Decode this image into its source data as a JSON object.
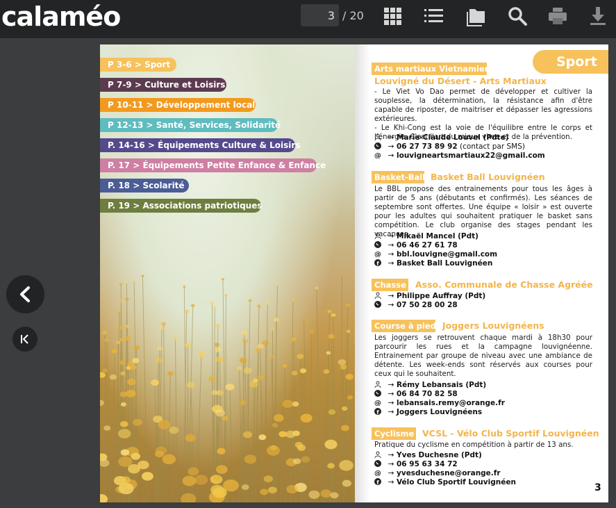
{
  "app": {
    "logo": "calaméo"
  },
  "toolbar": {
    "current_page": "3",
    "total_pages": "/ 20",
    "icons": [
      "grid-view-icon",
      "list-view-icon",
      "folder-icon",
      "search-icon",
      "print-icon",
      "download-icon"
    ]
  },
  "nav": {
    "prev_icon": "chevron-left-icon",
    "first_icon": "first-page-icon"
  },
  "index": [
    {
      "label": "P 3-6  >  Sport",
      "color": "#f7c15b"
    },
    {
      "label": "P 7-9  >  Culture et Loisirs",
      "color": "#5c3b4f"
    },
    {
      "label": "P 10-11  >  Développement local",
      "color": "#f29a1f"
    },
    {
      "label": "P 12-13  >  Santé, Services, Solidarité",
      "color": "#5fbcbf"
    },
    {
      "label": "P. 14-16  >  Équipements Culture & Loisirs",
      "color": "#544a8c"
    },
    {
      "label": "P. 17  >  Équipements Petite Enfance & Enfance",
      "color": "#cf7fa3"
    },
    {
      "label": "P. 18  >  Scolarité",
      "color": "#4b5c96"
    },
    {
      "label": "P. 19  >  Associations patriotiques",
      "color": "#6e7e3f"
    }
  ],
  "right_page": {
    "section_tab": "Sport",
    "page_number": "3",
    "sections": [
      {
        "category": "Arts martiaux Vietnamiens",
        "club": "Louvigné du Désert - Arts Martiaux",
        "paragraph_lines": [
          "- Le Viet Vo Dao permet de développer et cultiver la souplesse, la détermination, la résistance afin d'être capable de riposter, de maitriser et dépasser les agressions extérieures.",
          "- Le Khi-Cong est la voie de l'équilibre entre le corps et l'énergie. C'est l'art du mieux vivre et de la prévention."
        ],
        "contacts": [
          {
            "icon": "person-icon",
            "text": "Marie-Claude Louvel (Pdte)",
            "note": ""
          },
          {
            "icon": "phone-icon",
            "text": "06 27 73 89 92",
            "note": " (contact par SMS)"
          },
          {
            "icon": "at-icon",
            "text": "louvigneartsmartiaux22@gmail.com",
            "note": ""
          }
        ]
      },
      {
        "category": "Basket-Ball",
        "club": "Basket Ball Louvignéen",
        "paragraph_lines": [
          "Le BBL propose des entrainements pour tous les âges à partir de 5 ans (débutants et confirmés). Les séances de septembre sont offertes. Une équipe « loisir » est ouverte pour les adultes qui souhaitent pratiquer le basket sans compétition. Le club organise des stages pendant les vacances."
        ],
        "contacts": [
          {
            "icon": "person-icon",
            "text": "Mikaël Mancel (Pdt)",
            "note": ""
          },
          {
            "icon": "phone-icon",
            "text": "06 46 27 61 78",
            "note": ""
          },
          {
            "icon": "at-icon",
            "text": "bbl.louvigne@gmail.com",
            "note": ""
          },
          {
            "icon": "facebook-icon",
            "text": "Basket Ball Louvignéen",
            "note": ""
          }
        ]
      },
      {
        "category": "Chasse",
        "club": "Asso. Communale de Chasse Agréée",
        "paragraph_lines": [],
        "contacts": [
          {
            "icon": "person-icon",
            "text": "Philippe Auffray (Pdt)",
            "note": ""
          },
          {
            "icon": "phone-icon",
            "text": "07 50 28 00 28",
            "note": ""
          }
        ]
      },
      {
        "category": "Course à pied",
        "club": "Joggers Louvignéens",
        "paragraph_lines": [
          "Les joggers se retrouvent chaque mardi à 18h30 pour parcourir les rues et la campagne louvignéenne. Entrainement par groupe de niveau avec une ambiance de détente. Les week-ends sont réservés aux courses pour ceux qui le souhaitent."
        ],
        "contacts": [
          {
            "icon": "person-icon",
            "text": "Rémy Lebansais (Pdt)",
            "note": ""
          },
          {
            "icon": "phone-icon",
            "text": "06 84 70 82 58",
            "note": ""
          },
          {
            "icon": "at-icon",
            "text": "lebansais.remy@orange.fr",
            "note": ""
          },
          {
            "icon": "facebook-icon",
            "text": "Joggers Louvignéens",
            "note": ""
          }
        ]
      },
      {
        "category": "Cyclisme",
        "club": "VCSL - Vélo Club Sportif Louvignéen",
        "paragraph_lines": [
          "Pratique du cyclisme en compétition à partir de 13 ans."
        ],
        "contacts": [
          {
            "icon": "person-icon",
            "text": "Yves Duchesne (Pdt)",
            "note": ""
          },
          {
            "icon": "phone-icon",
            "text": "06 95 63 34 72",
            "note": ""
          },
          {
            "icon": "at-icon",
            "text": "yvesduchesne@orange.fr",
            "note": ""
          },
          {
            "icon": "facebook-icon",
            "text": "Vélo Club Sportif Louvignéen",
            "note": ""
          }
        ]
      }
    ]
  }
}
